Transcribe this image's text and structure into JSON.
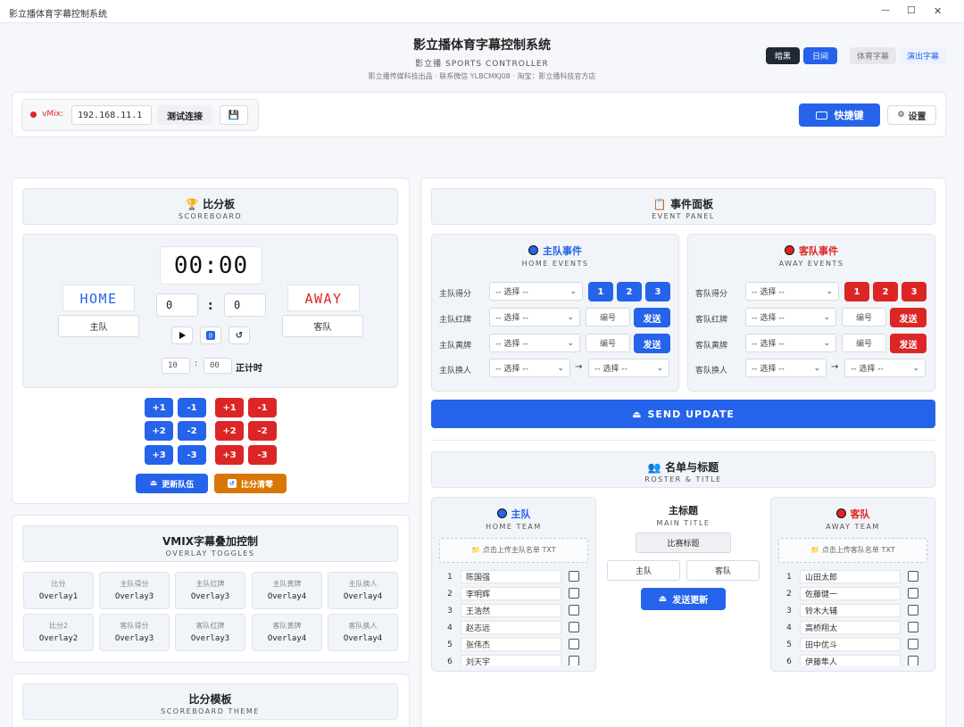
{
  "window": {
    "title": "影立播体育字幕控制系统",
    "minimize": "—",
    "maximize": "☐",
    "close": "✕"
  },
  "header": {
    "title": "影立播体育字幕控制系统",
    "subtitle": "影立播 SPORTS CONTROLLER",
    "credits": "影立播传媒科技出品 · 联系微信 YLBCMKJ08 · 淘宝：影立播科技官方店",
    "theme_dark": "暗黑",
    "theme_day": "日间",
    "tab_sports": "体育字幕",
    "tab_show": "演出字幕"
  },
  "connection": {
    "label": "vMix:",
    "ip": "192.168.11.1",
    "test_button": "测试连接",
    "save_icon": "💾",
    "shortcut_button": "快捷键",
    "settings_button": "设置"
  },
  "scoreboard": {
    "title": "比分板",
    "subtitle": "SCOREBOARD",
    "clock": "00:00",
    "home_label": "HOME",
    "away_label": "AWAY",
    "home_name": "主队",
    "away_name": "客队",
    "home_score": "0",
    "away_score": "0",
    "minutes": "10",
    "seconds": "00",
    "countdown_label": "正计时",
    "adjust": [
      "+1",
      "-1",
      "+2",
      "-2",
      "+3",
      "-3"
    ],
    "update_button": "更新队伍",
    "reset_button": "比分清零"
  },
  "overlay": {
    "title": "VMIX字幕叠加控制",
    "subtitle": "OVERLAY TOGGLES",
    "items": [
      {
        "label": "比分",
        "value": "Overlay1"
      },
      {
        "label": "主队得分",
        "value": "Overlay3"
      },
      {
        "label": "主队红牌",
        "value": "Overlay3"
      },
      {
        "label": "主队黄牌",
        "value": "Overlay4"
      },
      {
        "label": "主队换人",
        "value": "Overlay4"
      },
      {
        "label": "比分2",
        "value": "Overlay2"
      },
      {
        "label": "客队得分",
        "value": "Overlay3"
      },
      {
        "label": "客队红牌",
        "value": "Overlay3"
      },
      {
        "label": "客队黄牌",
        "value": "Overlay4"
      },
      {
        "label": "客队换人",
        "value": "Overlay4"
      }
    ]
  },
  "theme": {
    "title": "比分模板",
    "subtitle": "SCOREBOARD THEME"
  },
  "events": {
    "title": "事件面板",
    "subtitle": "EVENT PANEL",
    "select_placeholder": "-- 选择 --",
    "number_placeholder": "编号",
    "send_label": "发送",
    "home": {
      "title": "主队事件",
      "subtitle": "HOME EVENTS",
      "score": "主队得分",
      "red": "主队红牌",
      "yellow": "主队黄牌",
      "sub": "主队换人"
    },
    "away": {
      "title": "客队事件",
      "subtitle": "AWAY EVENTS",
      "score": "客队得分",
      "red": "客队红牌",
      "yellow": "客队黄牌",
      "sub": "客队换人"
    },
    "points": [
      "1",
      "2",
      "3"
    ],
    "send_update": "SEND UPDATE"
  },
  "roster": {
    "title": "名单与标题",
    "subtitle": "ROSTER & TITLE",
    "home_title": "主队",
    "home_sub": "HOME TEAM",
    "home_upload": "点击上传主队名单 TXT",
    "away_title": "客队",
    "away_sub": "AWAY TEAM",
    "away_upload": "点击上传客队名单 TXT",
    "main_title": "主标题",
    "main_sub": "MAIN TITLE",
    "match_title": "比赛标题",
    "home_field": "主队",
    "away_field": "客队",
    "send_button": "发送更新",
    "home_players": [
      "陈国强",
      "李明辉",
      "王浩然",
      "赵志远",
      "张伟杰",
      "刘天宇"
    ],
    "away_players": [
      "山田太郎",
      "佐藤健一",
      "铃木大辅",
      "高桥翔太",
      "田中优斗",
      "伊藤隼人"
    ]
  },
  "colors": {
    "blue": "#2563eb",
    "red": "#dc2626",
    "orange": "#d97706"
  }
}
